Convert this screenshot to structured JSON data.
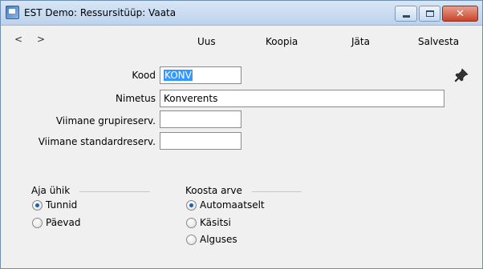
{
  "window": {
    "title": "EST Demo: Ressursitüüp: Vaata",
    "minimize_icon": "minimize-icon",
    "maximize_icon": "maximize-icon",
    "close_icon": "close-icon"
  },
  "toolbar": {
    "prev": "<",
    "next": ">",
    "new_label": "Uus",
    "copy_label": "Koopia",
    "cancel_label": "Jäta",
    "save_label": "Salvesta"
  },
  "form": {
    "code_label": "Kood",
    "code_value": "KONV",
    "name_label": "Nimetus",
    "name_value": "Konverents",
    "last_group_reserv_label": "Viimane grupireserv.",
    "last_group_reserv_value": "",
    "last_standard_reserv_label": "Viimane standardreserv.",
    "last_standard_reserv_value": ""
  },
  "time_unit": {
    "title": "Aja ühik",
    "options": [
      {
        "label": "Tunnid",
        "checked": true
      },
      {
        "label": "Päevad",
        "checked": false
      }
    ]
  },
  "invoice": {
    "title": "Koosta arve",
    "options": [
      {
        "label": "Automaatselt",
        "checked": true
      },
      {
        "label": "Käsitsi",
        "checked": false
      },
      {
        "label": "Alguses",
        "checked": false
      }
    ]
  },
  "colors": {
    "selection": "#3399ff",
    "titlebar": "#bcd2ec",
    "close_button": "#c9432a"
  }
}
